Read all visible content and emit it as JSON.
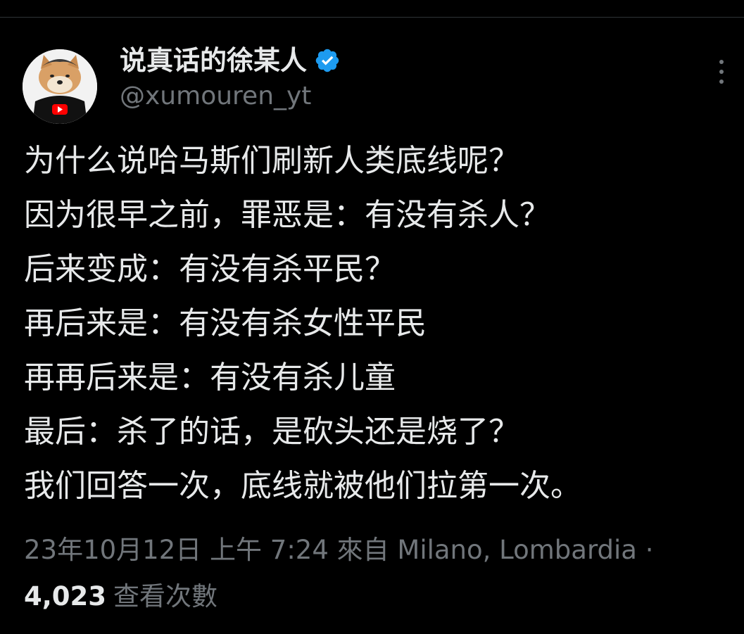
{
  "author": {
    "display_name": "说真话的徐某人",
    "handle": "@xumouren_yt",
    "verified": true,
    "verified_color": "#1d9bf0"
  },
  "icons": {
    "more": "more-vertical-icon",
    "verified": "verified-badge-icon",
    "avatar_badge": "youtube-logo-icon"
  },
  "tweet": {
    "lines": [
      "为什么说哈马斯们刷新人类底线呢？",
      "因为很早之前，罪恶是：有没有杀人？",
      "后来变成：有没有杀平民？",
      "再后来是：有没有杀女性平民",
      "再再后来是：有没有杀儿童",
      "最后：杀了的话，是砍头还是烧了？",
      "我们回答一次，底线就被他们拉第一次。"
    ]
  },
  "meta": {
    "date": "23年10月12日",
    "time": "上午 7:24",
    "source": "來自 Milano, Lombardia",
    "separator": "·"
  },
  "stats": {
    "views_count": "4,023",
    "views_label": "查看次數"
  },
  "colors": {
    "background": "#000000",
    "text": "#e7e9ea",
    "secondary_text": "#71767b",
    "divider": "#2f3336"
  }
}
